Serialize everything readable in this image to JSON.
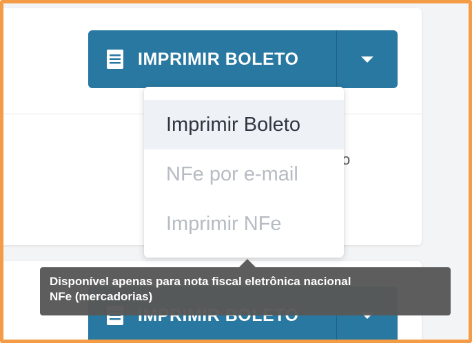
{
  "colors": {
    "accent": "#2878a1",
    "frame": "#f39b45",
    "tooltip_bg": "#585858"
  },
  "print_button": {
    "label": "IMPRIMIR BOLETO",
    "icon": "document-icon",
    "toggle_icon": "caret-down-icon"
  },
  "partial_text": "o",
  "dropdown": {
    "items": [
      {
        "label": "Imprimir Boleto",
        "state": "hover"
      },
      {
        "label": "NFe por e-mail",
        "state": "disabled"
      },
      {
        "label": "Imprimir NFe",
        "state": "disabled"
      }
    ]
  },
  "tooltip": {
    "line1": "Disponível apenas para nota fiscal eletrônica nacional",
    "line2": "NFe (mercadorias)"
  },
  "print_button_2": {
    "label": "IMPRIMIR BOLETO"
  }
}
